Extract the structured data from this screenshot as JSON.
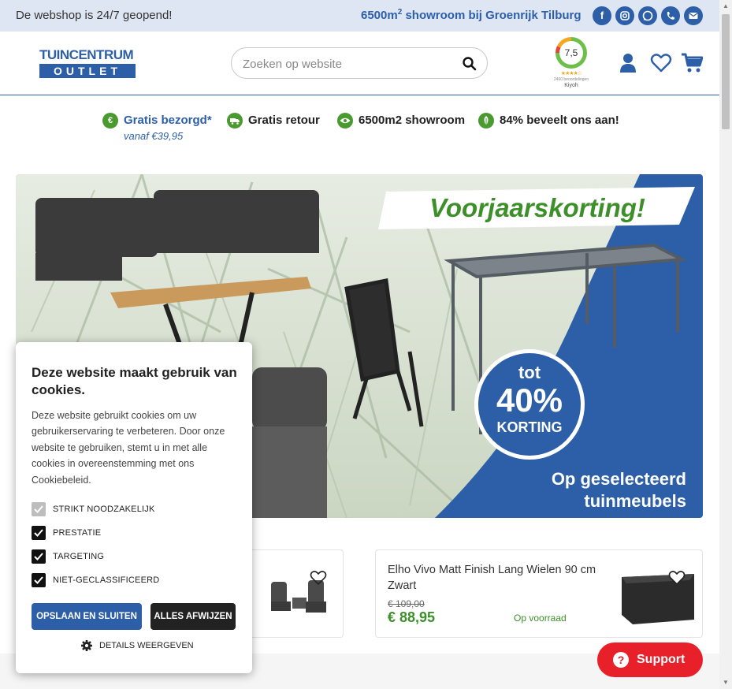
{
  "topbar": {
    "left_text": "De webshop is 24/7 geopend!",
    "showroom_text": "6500m",
    "showroom_sup": "2",
    "showroom_rest": " showroom bij Groenrijk Tilburg",
    "social_icons": [
      "facebook-icon",
      "instagram-icon",
      "whatsapp-icon",
      "phone-icon",
      "mail-icon"
    ]
  },
  "header": {
    "logo_line1": "TUINCENTRUM",
    "logo_line2": "OUTLET",
    "search_placeholder": "Zoeken op website",
    "kiyoh_score": "7,5",
    "kiyoh_stars": "★★★★☆",
    "kiyoh_reviews": "2460 beoordelingen",
    "kiyoh_brand": "Kiyoh"
  },
  "usps": [
    {
      "label": "Gratis bezorgd*",
      "icon": "euro-icon"
    },
    {
      "label": "Gratis retour",
      "icon": "truck-icon"
    },
    {
      "label": "6500m2 showroom",
      "icon": "eye-icon"
    },
    {
      "label": "84% beveelt ons aan!",
      "icon": "leaf-icon"
    }
  ],
  "usp_sub": "vanaf €39,95",
  "hero": {
    "headline": "Voorjaarskorting!",
    "badge_tot": "tot",
    "badge_pct": "40%",
    "badge_korting": "KORTING",
    "sub_line1": "Op geselecteerd",
    "sub_line2": "tuinmeubels"
  },
  "products": [
    {
      "title": "Elho Vivo Matt Finish Lang Wielen 90 cm Zwart",
      "old_price": "€ 109,00",
      "price": "€ 88,95",
      "stock": "Op voorraad"
    }
  ],
  "cookie": {
    "title": "Deze website maakt gebruik van cookies.",
    "description": "Deze website gebruikt cookies om uw gebruikerservaring te verbeteren. Door onze website te gebruiken, stemt u in met alle cookies in overeenstemming met ons Cookiebeleid.",
    "options": [
      {
        "label": "STRIKT NOODZAKELIJK",
        "checked": true,
        "disabled": true
      },
      {
        "label": "PRESTATIE",
        "checked": true,
        "disabled": false
      },
      {
        "label": "TARGETING",
        "checked": true,
        "disabled": false
      },
      {
        "label": "NIET-GECLASSIFICEERD",
        "checked": true,
        "disabled": false
      }
    ],
    "save_label": "OPSLAAN EN SLUITEN",
    "reject_label": "ALLES AFWIJZEN",
    "details_label": "DETAILS WEERGEVEN"
  },
  "support": {
    "label": "Support"
  },
  "colors": {
    "brand_blue": "#2d5fa8",
    "green": "#3d8f2a",
    "support_red": "#e8202a"
  }
}
